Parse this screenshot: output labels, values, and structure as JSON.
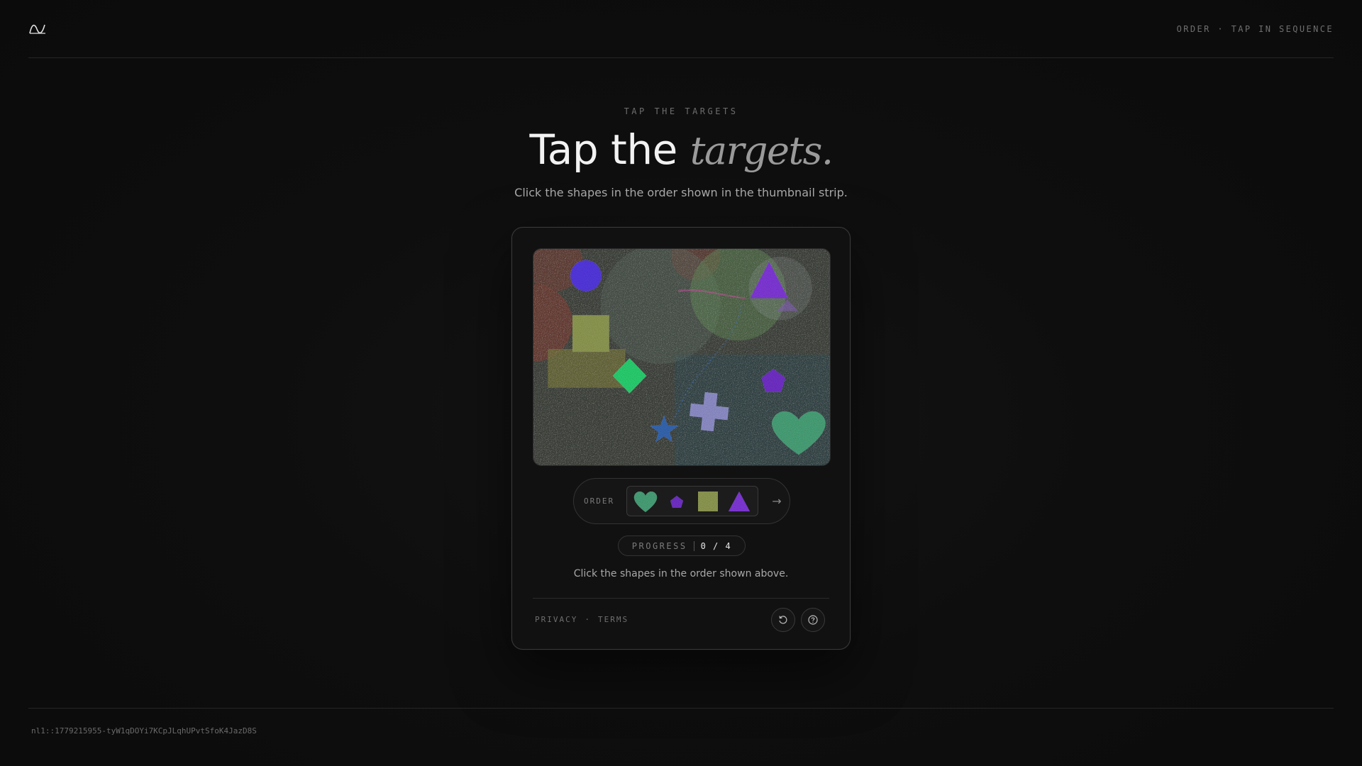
{
  "header": {
    "status_text": "ORDER · TAP IN SEQUENCE"
  },
  "hero": {
    "eyebrow": "TAP THE TARGETS",
    "title_plain": "Tap the ",
    "title_accent": "targets.",
    "subtitle": "Click the shapes in the order shown in the thumbnail strip."
  },
  "challenge": {
    "canvas_shapes": [
      {
        "shape": "circle",
        "color": "#5b3df0"
      },
      {
        "shape": "triangle",
        "color": "#8a3de8"
      },
      {
        "shape": "square",
        "color": "#9aa55a"
      },
      {
        "shape": "diamond",
        "color": "#2ee07a"
      },
      {
        "shape": "pentagon",
        "color": "#7a35d6"
      },
      {
        "shape": "cross",
        "color": "#9a9ad8"
      },
      {
        "shape": "star",
        "color": "#3a6fbf"
      },
      {
        "shape": "heart",
        "color": "#4fae82"
      }
    ],
    "order_label": "ORDER",
    "order_sequence": [
      {
        "shape": "heart",
        "color": "#4fae82"
      },
      {
        "shape": "pentagon",
        "color": "#7a35d6"
      },
      {
        "shape": "square",
        "color": "#9aa55a"
      },
      {
        "shape": "triangle",
        "color": "#8a3de8"
      }
    ],
    "next_arrow": "→",
    "progress_label": "PROGRESS",
    "progress_value": "0 / 4",
    "progress_done": 0,
    "progress_total": 4,
    "hint": "Click the shapes in the order shown above."
  },
  "footer": {
    "privacy": "PRIVACY",
    "separator": "·",
    "terms": "TERMS",
    "refresh_icon": "refresh-icon",
    "help_icon": "help-icon"
  },
  "session_id": "nl1::1779215955-tyW1qDOYi7KCpJLqhUPvtSfoK4JazD8S"
}
